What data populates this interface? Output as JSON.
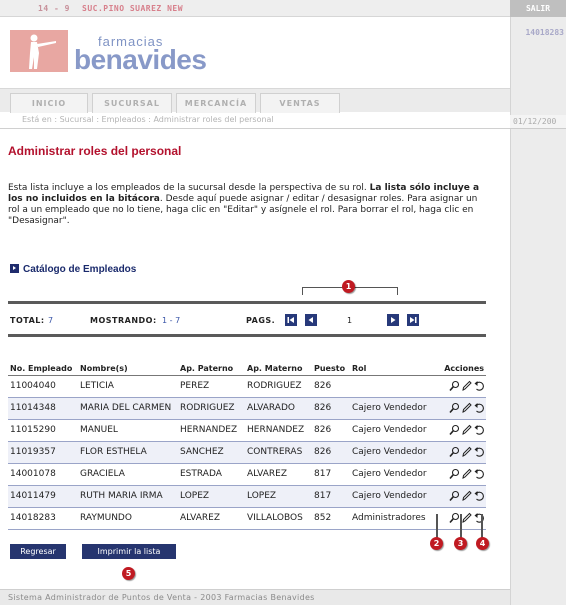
{
  "header": {
    "store_number": "14 - 9",
    "store_name": "SUC.PINO SUAREZ NEW",
    "logout_label": "SALIR",
    "employee_id": "14018283",
    "date": "01/12/200",
    "logo_top": "farmacias",
    "logo_bottom": "benavides"
  },
  "nav": {
    "tabs": [
      {
        "label": "INICIO"
      },
      {
        "label": "SUCURSAL"
      },
      {
        "label": "MERCANCÍA"
      },
      {
        "label": "VENTAS"
      }
    ]
  },
  "breadcrumb": "Está en : Sucursal : Empleados : Administrar roles del personal",
  "page": {
    "title": "Administrar roles del personal",
    "desc_intro": "Esta lista incluye a los empleados de la sucursal desde la perspectiva de su rol. ",
    "desc_bold": "La lista sólo incluye a los no incluidos en la bitácora",
    "desc_rest": ". Desde aquí puede asignar / editar / desasignar roles. Para asignar un rol a un empleado que no lo tiene, haga clic en \"Editar\" y asígnele el rol. Para borrar el rol, haga clic en \"Desasignar\".",
    "catalog_title": "Catálogo de Empleados"
  },
  "pager": {
    "total_label": "TOTAL:",
    "total_value": "7",
    "showing_label": "MOSTRANDO:",
    "showing_value": "1 - 7",
    "pages_label": "PAGS.",
    "current_page": "1"
  },
  "table": {
    "columns": [
      "No. Empleado",
      "Nombre(s)",
      "Ap. Paterno",
      "Ap. Materno",
      "Puesto",
      "Rol",
      "Acciones"
    ],
    "rows": [
      {
        "num": "11004040",
        "name": "LETICIA",
        "pat": "PEREZ",
        "mat": "RODRIGUEZ",
        "puesto": "826",
        "rol": ""
      },
      {
        "num": "11014348",
        "name": "MARIA DEL CARMEN",
        "pat": "RODRIGUEZ",
        "mat": "ALVARADO",
        "puesto": "826",
        "rol": "Cajero Vendedor"
      },
      {
        "num": "11015290",
        "name": "MANUEL",
        "pat": "HERNANDEZ",
        "mat": "HERNANDEZ",
        "puesto": "826",
        "rol": "Cajero Vendedor"
      },
      {
        "num": "11019357",
        "name": "FLOR ESTHELA",
        "pat": "SANCHEZ",
        "mat": "CONTRERAS",
        "puesto": "826",
        "rol": "Cajero Vendedor"
      },
      {
        "num": "14001078",
        "name": "GRACIELA",
        "pat": "ESTRADA",
        "mat": "ALVAREZ",
        "puesto": "817",
        "rol": "Cajero Vendedor"
      },
      {
        "num": "14011479",
        "name": "RUTH MARIA IRMA",
        "pat": "LOPEZ",
        "mat": "LOPEZ",
        "puesto": "817",
        "rol": "Cajero Vendedor"
      },
      {
        "num": "14018283",
        "name": "RAYMUNDO",
        "pat": "ALVAREZ",
        "mat": "VILLALOBOS",
        "puesto": "852",
        "rol": "Administradores"
      }
    ]
  },
  "buttons": {
    "back": "Regresar",
    "print": "Imprimir la lista"
  },
  "callouts": [
    "1",
    "2",
    "3",
    "4",
    "5"
  ],
  "footer": "Sistema Administrador de Puntos de Venta - 2003 Farmacias Benavides",
  "colors": {
    "title_red": "#b3112d",
    "navy": "#26356f",
    "callout_red": "#c01a22",
    "link_blue": "#3a56a8"
  }
}
